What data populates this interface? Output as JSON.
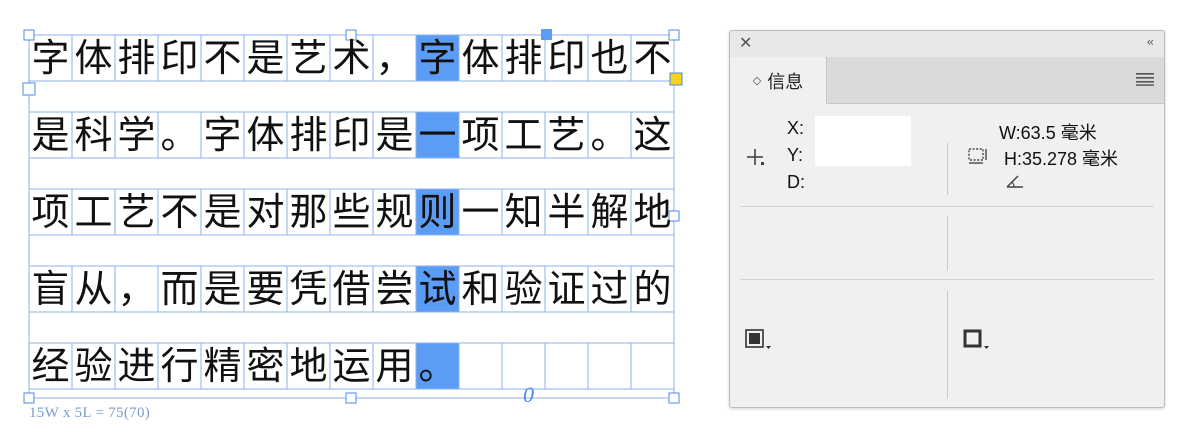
{
  "frame": {
    "lines": [
      [
        "字",
        "体",
        "排",
        "印",
        "不",
        "是",
        "艺",
        "术",
        "，",
        "字",
        "体",
        "排",
        "印",
        "也",
        "不"
      ],
      [
        "是",
        "科",
        "学",
        "。",
        "字",
        "体",
        "排",
        "印",
        "是",
        "一",
        "项",
        "工",
        "艺",
        "。",
        "这"
      ],
      [
        "项",
        "工",
        "艺",
        "不",
        "是",
        "对",
        "那",
        "些",
        "规",
        "则",
        "一",
        "知",
        "半",
        "解",
        "地"
      ],
      [
        "盲",
        "从",
        "，",
        "而",
        "是",
        "要",
        "凭",
        "借",
        "尝",
        "试",
        "和",
        "验",
        "证",
        "过",
        "的"
      ],
      [
        "经",
        "验",
        "进",
        "行",
        "精",
        "密",
        "地",
        "运",
        "用",
        "。",
        "",
        "",
        "",
        "",
        ""
      ]
    ],
    "grid_count_label": "15W x 5L = 75(70)",
    "overset_mark": "0",
    "highlight_color": "#5b9cf5"
  },
  "panel": {
    "close_glyph": "✕",
    "collapse_glyph": "‹‹",
    "tab_label": "信息",
    "tab_updown_glyph": "◇",
    "x_label": "X:",
    "y_label": "Y:",
    "d_label": "D:",
    "w_value": "W:63.5 毫米",
    "h_value": "H:35.278 毫米",
    "icons": {
      "position": "crosshair-icon",
      "size": "dimensions-icon",
      "angle": "angle-icon",
      "fill": "fill-swatch-icon",
      "stroke": "stroke-swatch-icon",
      "menu": "panel-menu-icon"
    }
  }
}
